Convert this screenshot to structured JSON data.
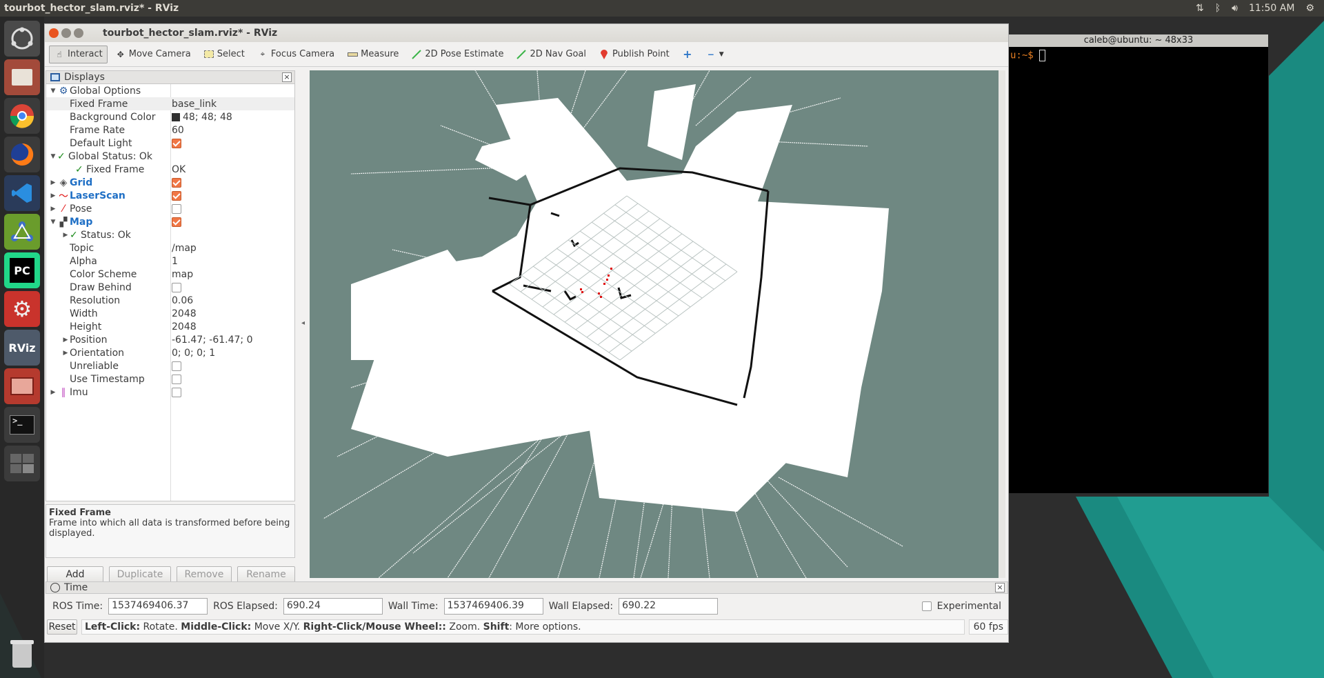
{
  "os": {
    "topbar_title": "tourbot_hector_slam.rviz* - RViz",
    "clock": "11:50 AM",
    "indicators": [
      "network-icon",
      "bluetooth-icon",
      "volume-icon",
      "settings-icon"
    ],
    "launcher": [
      "ubuntu-dash-icon",
      "files-icon",
      "chrome-icon",
      "firefox-icon",
      "vscode-icon",
      "network-app-icon",
      "pycharm-icon",
      "system-settings-icon",
      "rviz-icon",
      "sticky-notes-icon",
      "terminal-icon",
      "workspace-switcher-icon",
      "trash-icon"
    ],
    "launcher_labels": {
      "pycharm": "PC",
      "rviz": "RViz"
    }
  },
  "terminal": {
    "title": "caleb@ubuntu: ~ 48x33",
    "prompt": "u:~$ "
  },
  "rviz": {
    "title": "tourbot_hector_slam.rviz* - RViz",
    "toolbar": {
      "interact": "Interact",
      "move_camera": "Move Camera",
      "select": "Select",
      "focus_camera": "Focus Camera",
      "measure": "Measure",
      "pose_estimate": "2D Pose Estimate",
      "nav_goal": "2D Nav Goal",
      "publish_point": "Publish Point"
    },
    "displays": {
      "header": "Displays",
      "rows": [
        {
          "label": "Global Options",
          "value": ""
        },
        {
          "label": "Fixed Frame",
          "value": "base_link"
        },
        {
          "label": "Background Color",
          "value": "48; 48; 48"
        },
        {
          "label": "Frame Rate",
          "value": "60"
        },
        {
          "label": "Default Light",
          "value": ""
        },
        {
          "label": "Global Status: Ok",
          "value": ""
        },
        {
          "label": "Fixed Frame",
          "value": "OK"
        },
        {
          "label": "Grid",
          "value": ""
        },
        {
          "label": "LaserScan",
          "value": ""
        },
        {
          "label": "Pose",
          "value": ""
        },
        {
          "label": "Map",
          "value": ""
        },
        {
          "label": "Status: Ok",
          "value": ""
        },
        {
          "label": "Topic",
          "value": "/map"
        },
        {
          "label": "Alpha",
          "value": "1"
        },
        {
          "label": "Color Scheme",
          "value": "map"
        },
        {
          "label": "Draw Behind",
          "value": ""
        },
        {
          "label": "Resolution",
          "value": "0.06"
        },
        {
          "label": "Width",
          "value": "2048"
        },
        {
          "label": "Height",
          "value": "2048"
        },
        {
          "label": "Position",
          "value": "-61.47; -61.47; 0"
        },
        {
          "label": "Orientation",
          "value": "0; 0; 0; 1"
        },
        {
          "label": "Unreliable",
          "value": ""
        },
        {
          "label": "Use Timestamp",
          "value": ""
        },
        {
          "label": "Imu",
          "value": ""
        }
      ],
      "checks": {
        "default_light": true,
        "grid": true,
        "laserscan": true,
        "pose": false,
        "map": true,
        "draw_behind": false,
        "unreliable": false,
        "use_timestamp": false,
        "imu": false
      },
      "description_title": "Fixed Frame",
      "description_text": "Frame into which all data is transformed before being displayed.",
      "buttons": {
        "add": "Add",
        "duplicate": "Duplicate",
        "remove": "Remove",
        "rename": "Rename"
      }
    },
    "time": {
      "header": "Time",
      "ros_time_label": "ROS Time:",
      "ros_time": "1537469406.37",
      "ros_elapsed_label": "ROS Elapsed:",
      "ros_elapsed": "690.24",
      "wall_time_label": "Wall Time:",
      "wall_time": "1537469406.39",
      "wall_elapsed_label": "Wall Elapsed:",
      "wall_elapsed": "690.22",
      "experimental": "Experimental"
    },
    "status": {
      "reset": "Reset",
      "hint_left_b": "Left-Click:",
      "hint_left": " Rotate. ",
      "hint_mid_b": "Middle-Click:",
      "hint_mid": " Move X/Y. ",
      "hint_right_b": "Right-Click/Mouse Wheel::",
      "hint_right": " Zoom. ",
      "hint_shift_b": "Shift",
      "hint_shift": ": More options.",
      "fps": "60 fps"
    },
    "colors": {
      "viewport": "#6f8882",
      "check_on": "#f07746",
      "laser": "#e01010"
    }
  }
}
